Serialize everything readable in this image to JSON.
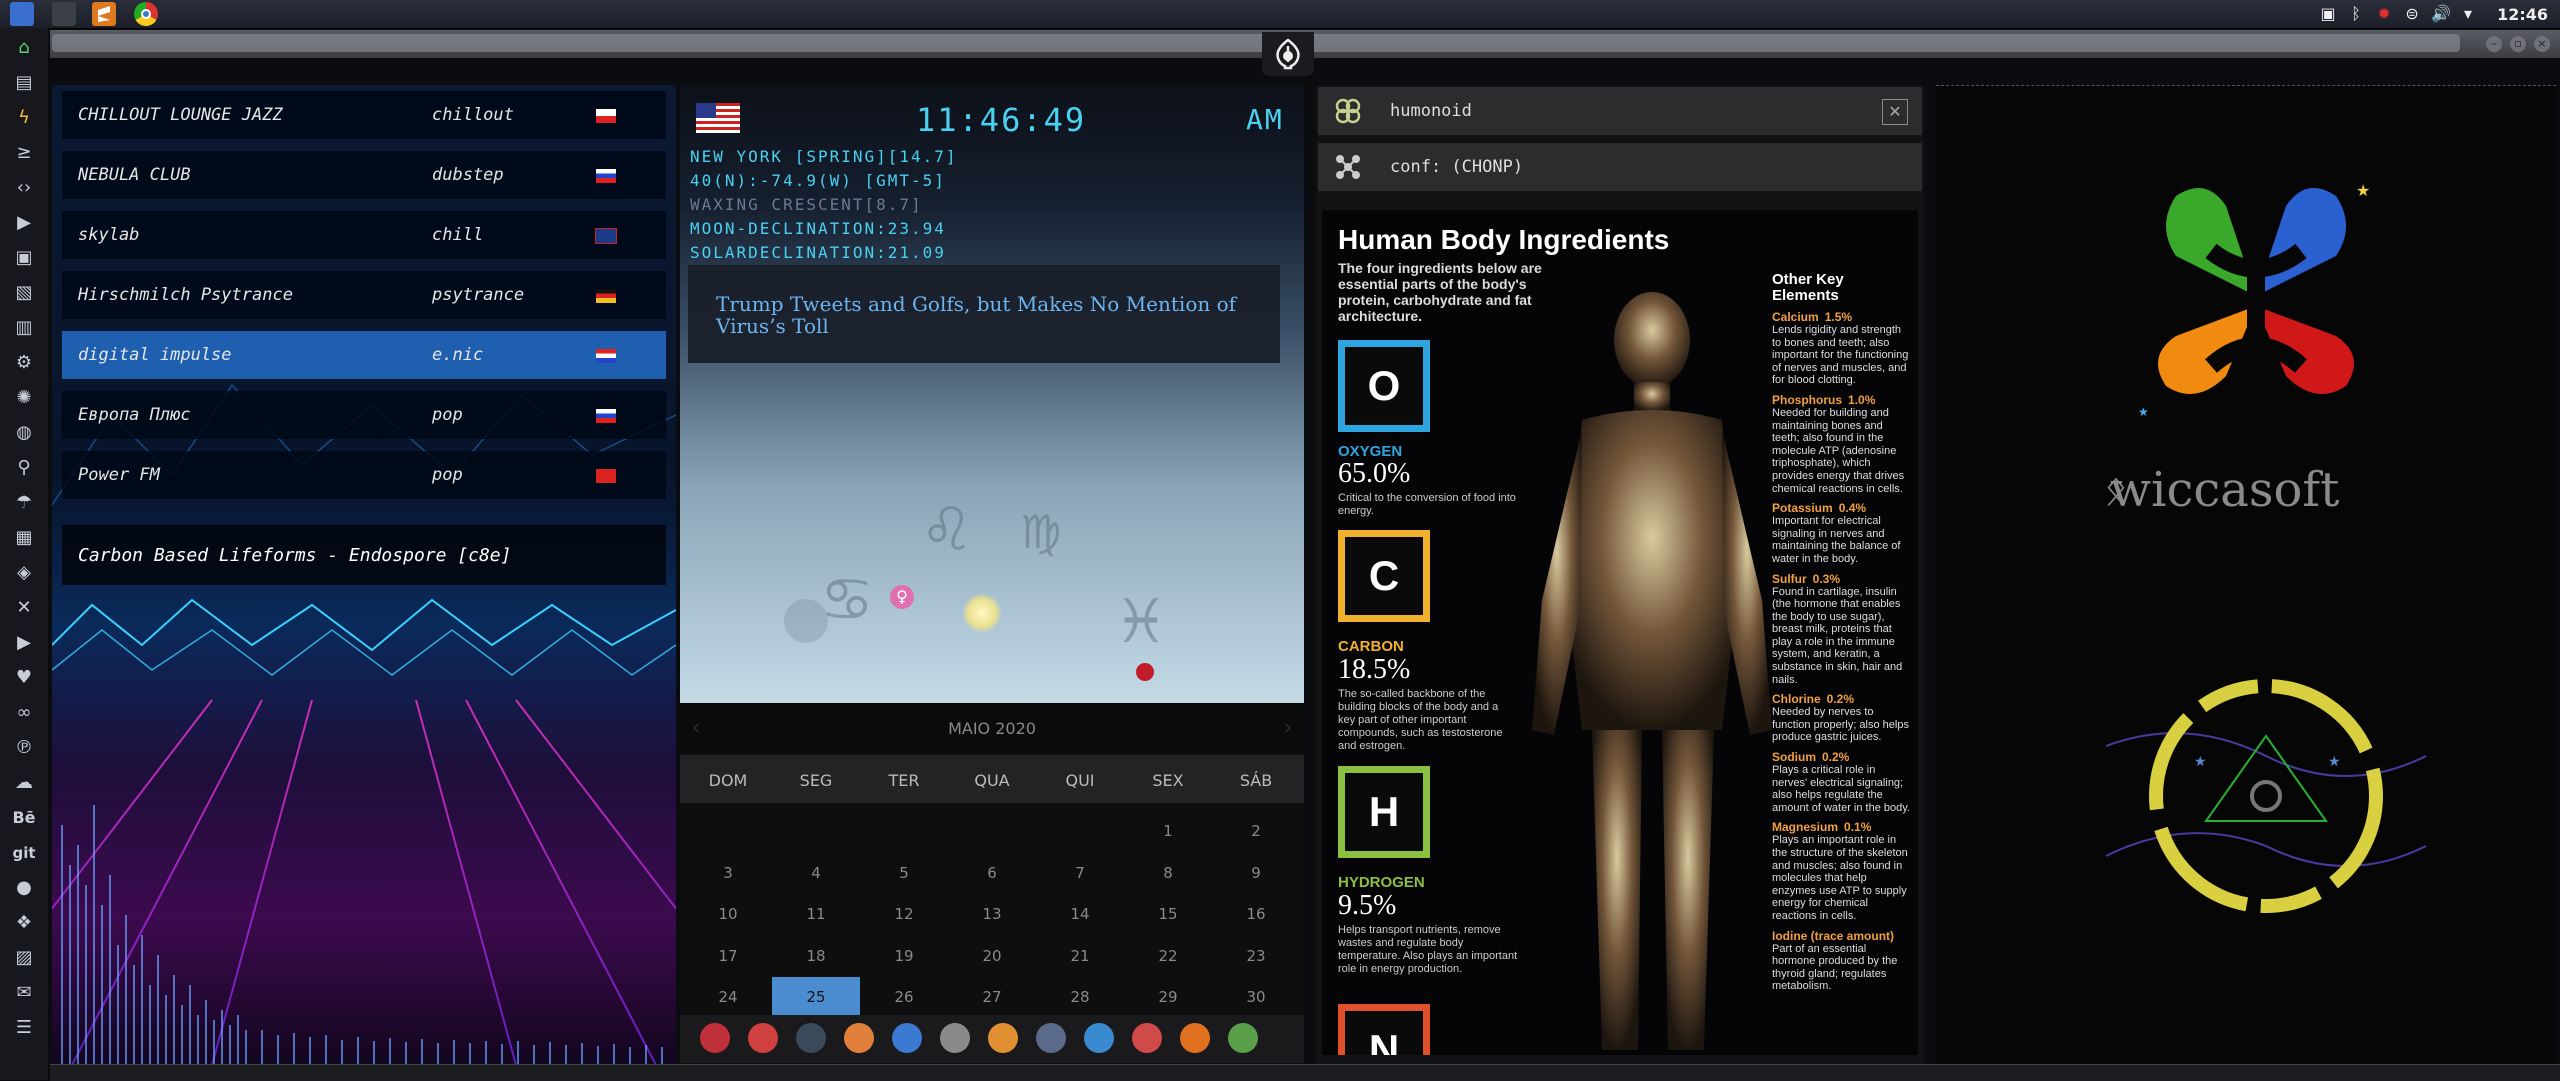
{
  "topbar": {
    "clock": "12:46",
    "apps": [
      "files-icon",
      "blank-app-icon",
      "sublime-icon",
      "chrome-icon"
    ],
    "tray": [
      "screenshot-icon",
      "bluetooth-icon",
      "updates-icon",
      "wifi-icon",
      "volume-icon",
      "dropdown-icon"
    ]
  },
  "window": {
    "emblem": "rebel-alliance-icon"
  },
  "dock": {
    "items": [
      "home-icon",
      "document-icon",
      "bolt-icon",
      "terminal-icon",
      "code-icon",
      "play-icon",
      "video-icon",
      "image-icon",
      "news-icon",
      "settings-icon",
      "network-icon",
      "globe-icon",
      "search-icon",
      "umbrella-icon",
      "id-card-icon",
      "tag-icon",
      "expand-icon",
      "youtube-icon",
      "heart-icon",
      "link-icon",
      "pinterest-icon",
      "cloud-icon",
      "behance-icon",
      "git-icon",
      "github-icon",
      "cubes-icon",
      "map-icon",
      "mail-icon",
      "list-icon"
    ],
    "labels": {
      "behance": "Bē",
      "git": "git"
    }
  },
  "radio": {
    "stations": [
      {
        "name": "CHILLOUT LOUNGE JAZZ",
        "genre": "chillout",
        "flag": "pl"
      },
      {
        "name": "NEBULA CLUB",
        "genre": "dubstep",
        "flag": "ru"
      },
      {
        "name": "skylab",
        "genre": "chill",
        "flag": "gb"
      },
      {
        "name": "Hirschmilch Psytrance",
        "genre": "psytrance",
        "flag": "de"
      },
      {
        "name": "digital impulse",
        "genre": "e.nic",
        "flag": "hr"
      },
      {
        "name": "Европа Плюс",
        "genre": "pop",
        "flag": "ru"
      },
      {
        "name": "Power FM",
        "genre": "pop",
        "flag": "tr"
      }
    ],
    "active_index": 4,
    "now_playing": "Carbon Based Lifeforms - Endospore [c8e]"
  },
  "sky": {
    "time": "11:46:49",
    "ampm": "AM",
    "lines": [
      "NEW YORK [SPRING][14.7]",
      "40(N):-74.9(W) [GMT-5]",
      "WAXING CRESCENT[8.7]",
      "MOON-DECLINATION:23.94",
      "SOLARDECLINATION:21.09"
    ],
    "news": "Trump Tweets and Golfs, but Makes No Mention of Virus’s Toll"
  },
  "calendar": {
    "month": "MAIO 2020",
    "weekdays": [
      "DOM",
      "SEG",
      "TER",
      "QUA",
      "QUI",
      "SEX",
      "SÁB"
    ],
    "weeks": [
      [
        "",
        "",
        "",
        "",
        "",
        "1",
        "2"
      ],
      [
        "3",
        "4",
        "5",
        "6",
        "7",
        "8",
        "9"
      ],
      [
        "10",
        "11",
        "12",
        "13",
        "14",
        "15",
        "16"
      ],
      [
        "17",
        "18",
        "19",
        "20",
        "21",
        "22",
        "23"
      ],
      [
        "24",
        "25",
        "26",
        "27",
        "28",
        "29",
        "30"
      ]
    ],
    "today": "25"
  },
  "launcher": {
    "apps": [
      {
        "name": "app-red-icon",
        "color": "#c0303a"
      },
      {
        "name": "hourglass-icon",
        "color": "#d04040"
      },
      {
        "name": "globe-dark-icon",
        "color": "#3a4a5a"
      },
      {
        "name": "photos-icon",
        "color": "#e0803a"
      },
      {
        "name": "translate-icon",
        "color": "#3a7ad0"
      },
      {
        "name": "calendar-sheet-icon",
        "color": "#8a8a8a"
      },
      {
        "name": "search-app-icon",
        "color": "#e09030"
      },
      {
        "name": "clock-app-icon",
        "color": "#5a6a8a"
      },
      {
        "name": "web-icon",
        "color": "#3a8ad0"
      },
      {
        "name": "calendar-app-icon",
        "color": "#d04a4a"
      },
      {
        "name": "arrow-app-icon",
        "color": "#e07020"
      },
      {
        "name": "yandex-icon",
        "color": "#5aa04a"
      }
    ]
  },
  "infopanel": {
    "header1": "humonoid",
    "header2": "conf: (CHONP)"
  },
  "poster": {
    "title": "Human Body Ingredients",
    "subtitle": "The four ingredients below are essential parts of the body's protein, carbohydrate and fat architecture.",
    "elements": [
      {
        "symbol": "O",
        "name": "OXYGEN",
        "pct": "65.0%",
        "desc": "Critical to the conversion of food into energy.",
        "color": "#2ea4e0"
      },
      {
        "symbol": "C",
        "name": "CARBON",
        "pct": "18.5%",
        "desc": "The so-called backbone of the building blocks of the body and a key part of other important compounds, such as testosterone and estrogen.",
        "color": "#f0b030"
      },
      {
        "symbol": "H",
        "name": "HYDROGEN",
        "pct": "9.5%",
        "desc": "Helps transport nutrients, remove wastes and regulate body temperature. Also plays an important role in energy production.",
        "color": "#8cc040"
      },
      {
        "symbol": "N",
        "name": "",
        "pct": "",
        "desc": "",
        "color": "#e0502a"
      }
    ],
    "other_title": "Other Key Elements",
    "others": [
      {
        "name": "Calcium",
        "pct": "1.5%",
        "desc": "Lends rigidity and strength to bones and teeth; also important for the functioning of nerves and muscles, and for blood clotting."
      },
      {
        "name": "Phosphorus",
        "pct": "1.0%",
        "desc": "Needed for building and maintaining bones and teeth; also found in the molecule ATP (adenosine triphosphate), which provides energy that drives chemical reactions in cells."
      },
      {
        "name": "Potassium",
        "pct": "0.4%",
        "desc": "Important for electrical signaling in nerves and maintaining the balance of water in the body."
      },
      {
        "name": "Sulfur",
        "pct": "0.3%",
        "desc": "Found in cartilage, insulin (the hormone that enables the body to use sugar), breast milk, proteins that play a role in the immune system, and keratin, a substance in skin, hair and nails."
      },
      {
        "name": "Chlorine",
        "pct": "0.2%",
        "desc": "Needed by nerves to function properly; also helps produce gastric juices."
      },
      {
        "name": "Sodium",
        "pct": "0.2%",
        "desc": "Plays a critical role in nerves' electrical signaling; also helps regulate the amount of water in the body."
      },
      {
        "name": "Magnesium",
        "pct": "0.1%",
        "desc": "Plays an important role in the structure of the skeleton and muscles; also found in molecules that help enzymes use ATP to supply energy for chemical reactions in cells."
      },
      {
        "name": "Iodine (trace amount)",
        "pct": "",
        "desc": "Part of an essential hormone produced by the thyroid gland; regulates metabolism."
      }
    ]
  },
  "brand": {
    "name": "wiccasoft"
  },
  "colors": {
    "accent": "#4ad0f0",
    "active_station": "#1f5fb0",
    "today": "#4a8ccf"
  }
}
